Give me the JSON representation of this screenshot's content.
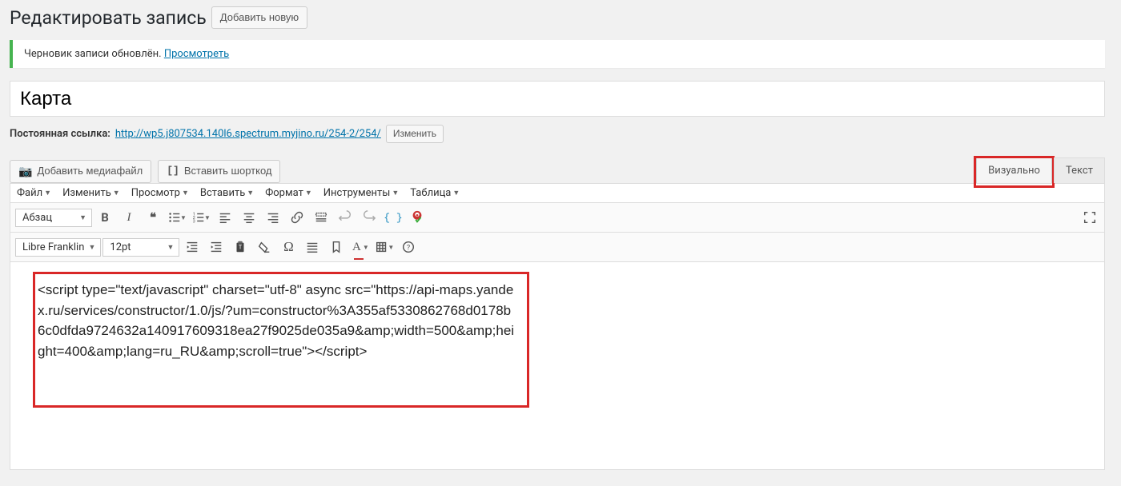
{
  "header": {
    "title": "Редактировать запись",
    "add_new": "Добавить новую"
  },
  "notice": {
    "text": "Черновик записи обновлён.",
    "view_link": "Просмотреть"
  },
  "post": {
    "title_value": "Карта",
    "permalink_label": "Постоянная ссылка:",
    "permalink_url": "http://wp5.j807534.140l6.spectrum.myjino.ru/254-2/254/",
    "permalink_edit": "Изменить"
  },
  "media_buttons": {
    "add_media": "Добавить медиафайл",
    "insert_shortcode": "Вставить шорткод"
  },
  "tabs": {
    "visual": "Визуально",
    "text": "Текст"
  },
  "menubar": [
    "Файл",
    "Изменить",
    "Просмотр",
    "Вставить",
    "Формат",
    "Инструменты",
    "Таблица"
  ],
  "toolbar1": {
    "format_select": "Абзац"
  },
  "toolbar2": {
    "font_select": "Libre Franklin",
    "size_select": "12pt"
  },
  "content": {
    "text": "<script type=\"text/javascript\" charset=\"utf-8\" async src=\"https://api-maps.yandex.ru/services/constructor/1.0/js/?um=constructor%3A355af5330862768d0178b6c0dfda9724632a140917609318ea27f9025de035a9&amp;width=500&amp;height=400&amp;lang=ru_RU&amp;scroll=true\"></script>"
  }
}
